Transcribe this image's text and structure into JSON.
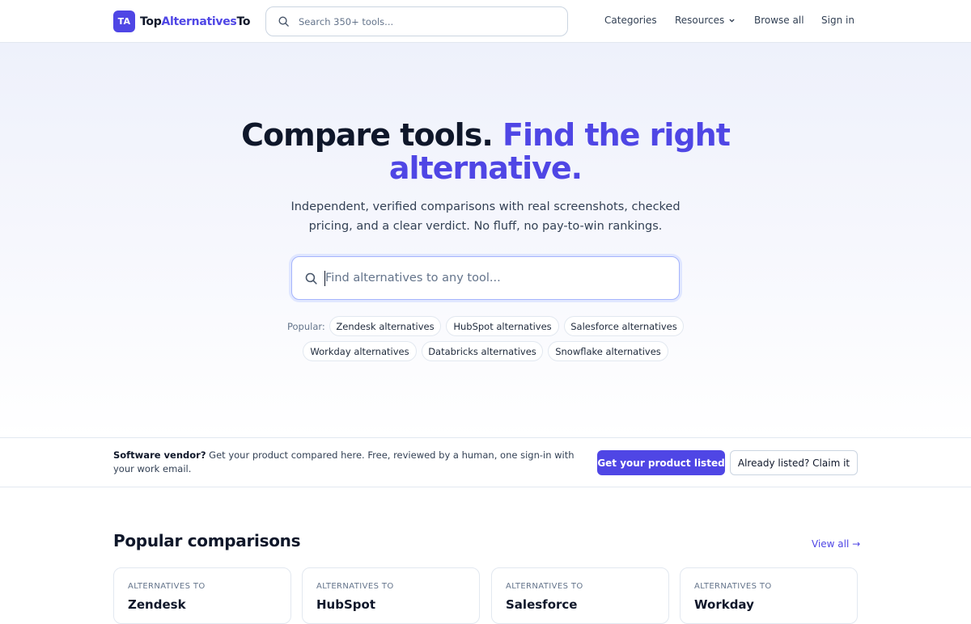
{
  "nav": {
    "logo_badge": "TA",
    "logo_text_1": "Top",
    "logo_text_2": "Alternatives",
    "logo_text_3": "To",
    "search_placeholder": "Search 350+ tools...",
    "links": {
      "categories": "Categories",
      "resources": "Resources",
      "browse_all": "Browse all",
      "sign_in": "Sign in"
    }
  },
  "hero": {
    "title_part1": "Compare tools.",
    "title_part2": "Find the right",
    "title_part3": "alternative.",
    "subtitle": "Independent, verified comparisons with real screenshots, checked pricing, and a clear verdict. No fluff, no pay-to-win rankings.",
    "search_placeholder": "Find alternatives to any tool...",
    "popular_label": "Popular:",
    "chips": [
      "Zendesk alternatives",
      "HubSpot alternatives",
      "Salesforce alternatives",
      "Workday alternatives",
      "Databricks alternatives",
      "Snowflake alternatives"
    ]
  },
  "vendor": {
    "lead": "Software vendor?",
    "text": " Get your product compared here. Free, reviewed by a human, one sign-in with your work email.",
    "primary_button": "Get your product listed",
    "secondary_button": "Already listed? Claim it"
  },
  "comparisons": {
    "title": "Popular comparisons",
    "view_all": "View all →",
    "cards": [
      {
        "kicker": "ALTERNATIVES TO",
        "name": "Zendesk"
      },
      {
        "kicker": "ALTERNATIVES TO",
        "name": "HubSpot"
      },
      {
        "kicker": "ALTERNATIVES TO",
        "name": "Salesforce"
      },
      {
        "kicker": "ALTERNATIVES TO",
        "name": "Workday"
      }
    ]
  },
  "colors": {
    "brand": "#4f46e5",
    "text": "#0f172a",
    "muted": "#64748b",
    "border": "#e2e8f0"
  },
  "icons": {
    "search": "search-icon",
    "chevron": "chevron-down-icon"
  }
}
